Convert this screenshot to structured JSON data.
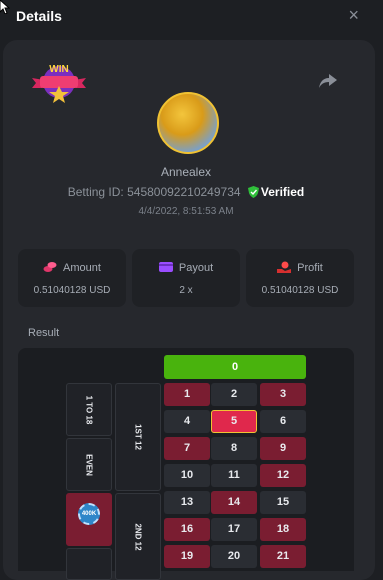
{
  "header": {
    "title": "Details",
    "close_label": "×"
  },
  "badge": {
    "text": "WIN"
  },
  "player": {
    "username": "Annealex",
    "betting_id_label": "Betting ID:",
    "betting_id": "545800922102497​34",
    "verified_label": "Verified",
    "date": "4/4/2022, 8:51:53 AM"
  },
  "stats": [
    {
      "label": "Amount",
      "value": "0.51040128 USD",
      "icon": "coins-icon"
    },
    {
      "label": "Payout",
      "value": "2 x",
      "icon": "wallet-icon"
    },
    {
      "label": "Profit",
      "value": "0.51040128 USD",
      "icon": "hand-money-icon"
    }
  ],
  "result": {
    "label": "Result",
    "zero": "0",
    "numbers": [
      [
        "1",
        "2",
        "3"
      ],
      [
        "4",
        "5",
        "6"
      ],
      [
        "7",
        "8",
        "9"
      ],
      [
        "10",
        "11",
        "12"
      ],
      [
        "13",
        "14",
        "15"
      ],
      [
        "16",
        "17",
        "18"
      ],
      [
        "19",
        "20",
        "21"
      ]
    ],
    "red_numbers": [
      "1",
      "3",
      "5",
      "7",
      "9",
      "12",
      "14",
      "16",
      "18",
      "19",
      "21"
    ],
    "winning_number": "5",
    "side_bets": [
      "1 TO 18",
      "EVEN"
    ],
    "dozens": [
      "1ST 12",
      "2ND 12"
    ],
    "chip_value": "400K",
    "colors": {
      "red": "#7a1d31",
      "green": "#49b30d",
      "highlight": "#e0284c"
    }
  }
}
